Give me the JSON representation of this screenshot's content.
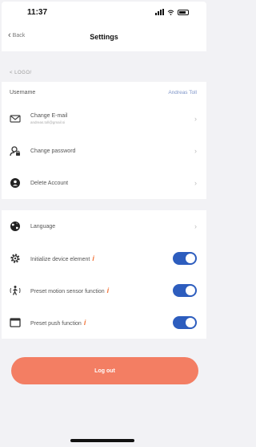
{
  "status_bar": {
    "time": "11:37"
  },
  "nav": {
    "back_label": "Back",
    "title": "Settings"
  },
  "section": {
    "header": "< LOGO/"
  },
  "account": {
    "username_label": "Username",
    "username_value": "Andreas Toll",
    "change_email_label": "Change E-mail",
    "change_email_sub": "andreas.toll@gmail.si",
    "change_password_label": "Change password",
    "delete_account_label": "Delete Account"
  },
  "settings": {
    "language_label": "Language",
    "initialize_label": "Initialize device element",
    "initialize_on": true,
    "motion_label": "Preset motion sensor function",
    "motion_on": true,
    "push_label": "Preset push function",
    "push_on": true,
    "warn_glyph": "i"
  },
  "logout_label": "Log out",
  "colors": {
    "accent": "#2d5dbe",
    "logout": "#f37e63",
    "warning": "#f2763c"
  }
}
